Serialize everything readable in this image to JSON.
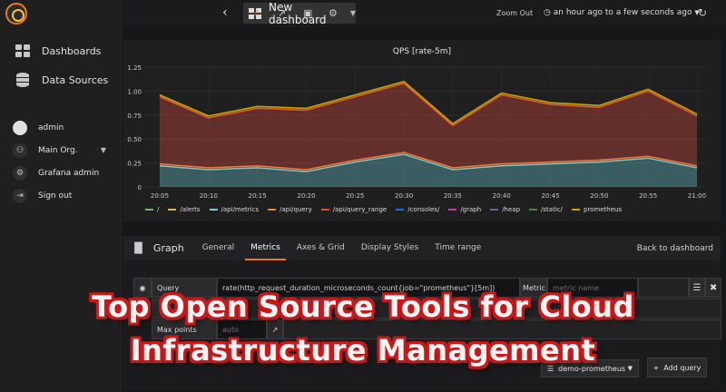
{
  "sidebar": {
    "nav": [
      {
        "label": "Dashboards",
        "icon": "dashboards-grid-icon"
      },
      {
        "label": "Data Sources",
        "icon": "database-icon"
      }
    ],
    "user": [
      {
        "label": "admin",
        "icon": "avatar"
      },
      {
        "label": "Main Org.",
        "icon": "org-icon"
      },
      {
        "label": "Grafana admin",
        "icon": "gear-icon"
      },
      {
        "label": "Sign out",
        "icon": "sign-out-icon"
      }
    ]
  },
  "topbar": {
    "dashboard_title": "New dashboard",
    "zoom_out": "Zoom Out",
    "time_range": "an hour ago to a few seconds ago"
  },
  "panel": {
    "title": "QPS [rate-5m]"
  },
  "chart_data": {
    "type": "area",
    "title": "QPS [rate-5m]",
    "stacked": true,
    "x": [
      "20:05",
      "20:10",
      "20:15",
      "20:20",
      "20:25",
      "20:30",
      "20:35",
      "20:40",
      "20:45",
      "20:50",
      "20:55",
      "21:00"
    ],
    "ylim": [
      0,
      1.25
    ],
    "yticks": [
      "0",
      "0.25",
      "0.50",
      "0.75",
      "1.00",
      "1.25"
    ],
    "series": [
      {
        "name": "/",
        "color": "#7eb26d",
        "values": [
          0,
          0,
          0,
          0,
          0,
          0,
          0,
          0,
          0,
          0,
          0,
          0
        ]
      },
      {
        "name": "/alerts",
        "color": "#eab839",
        "values": [
          0,
          0,
          0,
          0,
          0,
          0,
          0,
          0,
          0,
          0,
          0,
          0
        ]
      },
      {
        "name": "/api/metrics",
        "color": "#6ed0e0",
        "values": [
          0.22,
          0.18,
          0.2,
          0.16,
          0.26,
          0.34,
          0.18,
          0.22,
          0.24,
          0.26,
          0.3,
          0.2
        ]
      },
      {
        "name": "/api/query",
        "color": "#ef843c",
        "values": [
          0.02,
          0.02,
          0.02,
          0.02,
          0.02,
          0.02,
          0.02,
          0.02,
          0.02,
          0.02,
          0.02,
          0.02
        ]
      },
      {
        "name": "/api/query_range",
        "color": "#e24d42",
        "values": [
          0.7,
          0.52,
          0.6,
          0.62,
          0.66,
          0.72,
          0.44,
          0.72,
          0.6,
          0.55,
          0.68,
          0.52
        ]
      },
      {
        "name": "/consoles/",
        "color": "#1f78c1",
        "values": [
          0,
          0,
          0,
          0,
          0,
          0,
          0,
          0,
          0,
          0,
          0,
          0
        ]
      },
      {
        "name": "/graph",
        "color": "#ba43a9",
        "values": [
          0,
          0,
          0,
          0,
          0,
          0,
          0,
          0,
          0,
          0,
          0,
          0
        ]
      },
      {
        "name": "/heap",
        "color": "#705da0",
        "values": [
          0,
          0,
          0,
          0,
          0,
          0,
          0,
          0,
          0,
          0,
          0,
          0
        ]
      },
      {
        "name": "/static/",
        "color": "#508642",
        "values": [
          0,
          0,
          0,
          0,
          0,
          0,
          0,
          0,
          0,
          0,
          0,
          0
        ]
      },
      {
        "name": "prometheus",
        "color": "#cca300",
        "values": [
          0.02,
          0.02,
          0.02,
          0.02,
          0.02,
          0.02,
          0.02,
          0.02,
          0.02,
          0.02,
          0.02,
          0.02
        ]
      }
    ]
  },
  "editor": {
    "panel_type": "Graph",
    "tabs": [
      "General",
      "Metrics",
      "Axes & Grid",
      "Display Styles",
      "Time range"
    ],
    "active_tab": "Metrics",
    "back_label": "Back to dashboard",
    "query_label": "Query",
    "query_value": "rate(http_request_duration_microseconds_count{job=\"prometheus\"}[5m])",
    "metric_label": "Metric",
    "metric_placeholder": "metric name",
    "max_points_label": "Max points",
    "max_points_placeholder": "auto",
    "datasource": "demo-prometheus",
    "add_query": "Add query"
  },
  "headline": {
    "line1": "Top Open Source Tools for Cloud",
    "line2": "Infrastructure Management"
  }
}
